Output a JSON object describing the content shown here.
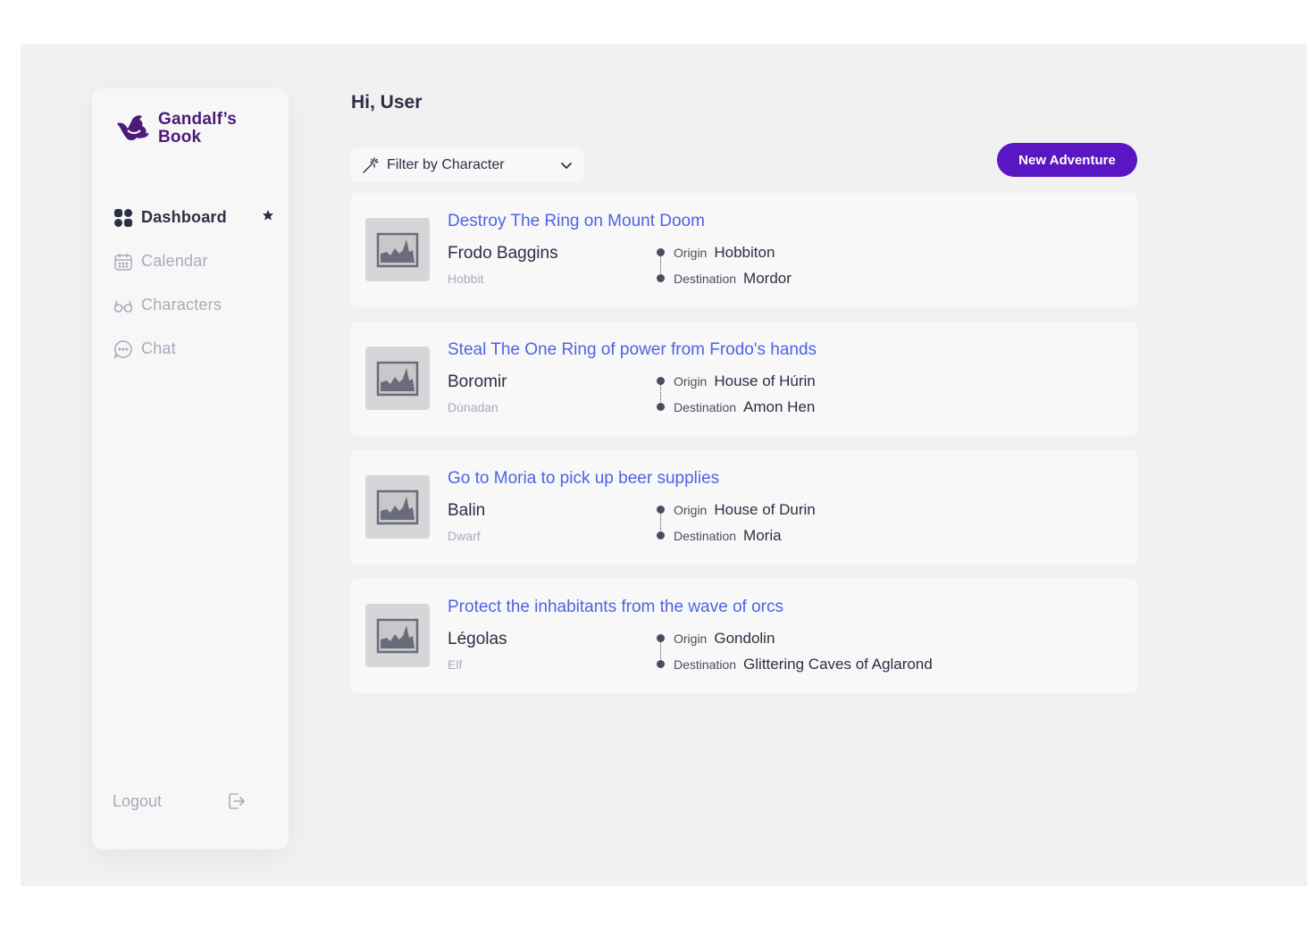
{
  "brand": {
    "line1": "Gandalf’s",
    "line2": "Book",
    "color": "#4d1a78"
  },
  "greeting": "Hi, User",
  "nav": {
    "items": [
      {
        "label": "Dashboard",
        "icon": "dashboard-grid-icon",
        "active": true
      },
      {
        "label": "Calendar",
        "icon": "calendar-icon",
        "active": false
      },
      {
        "label": "Characters",
        "icon": "glasses-icon",
        "active": false
      },
      {
        "label": "Chat",
        "icon": "chat-bubble-icon",
        "active": false
      }
    ],
    "logout": "Logout"
  },
  "filter": {
    "label": "Filter by Character",
    "icon": "magic-wand-icon"
  },
  "new_adventure": "New Adventure",
  "labels": {
    "origin": "Origin",
    "destination": "Destination"
  },
  "adventures": [
    {
      "title": "Destroy The Ring on Mount Doom",
      "character": "Frodo Baggins",
      "race": "Hobbit",
      "origin": "Hobbiton",
      "destination": "Mordor"
    },
    {
      "title": "Steal The One Ring of power from Frodo's hands",
      "character": "Boromir",
      "race": "Dúnadan",
      "origin": "House of Húrin",
      "destination": "Amon Hen"
    },
    {
      "title": "Go to Moria to pick up beer supplies",
      "character": "Balin",
      "race": "Dwarf",
      "origin": "House of Durin",
      "destination": "Moria"
    },
    {
      "title": "Protect the inhabitants from the wave of orcs",
      "character": "Légolas",
      "race": "Elf",
      "origin": "Gondolin",
      "destination": "Glittering Caves of Aglarond"
    }
  ],
  "colors": {
    "accent": "#5b16c4",
    "link": "#4e63e3",
    "text": "#2d2f44",
    "muted": "#a9abba"
  }
}
